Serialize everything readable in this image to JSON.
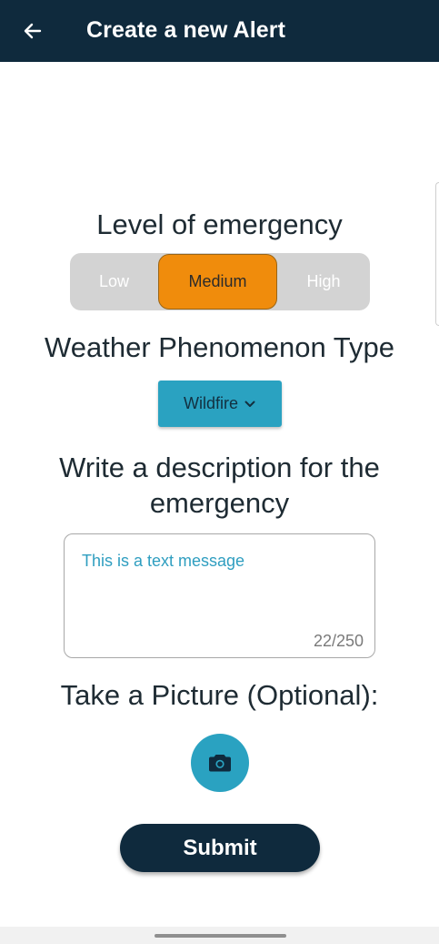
{
  "header": {
    "title": "Create a new Alert",
    "back_icon": "arrow-left-icon",
    "background_color": "#0f2a3d"
  },
  "emergency_level": {
    "label": "Level of emergency",
    "options": [
      "Low",
      "Medium",
      "High"
    ],
    "selected": "Medium",
    "selected_color": "#f08c0c"
  },
  "phenomenon": {
    "label": "Weather Phenomenon Type",
    "selected_value": "Wildfire",
    "icon": "chevron-down-icon",
    "color": "#2aa2c1"
  },
  "description": {
    "label_line1": "Write a description for the",
    "label_line2": "emergency",
    "value": "This is a text message",
    "char_count": "22/250"
  },
  "picture": {
    "label": "Take a Picture (Optional):",
    "icon": "camera-icon"
  },
  "submit": {
    "label": "Submit"
  }
}
